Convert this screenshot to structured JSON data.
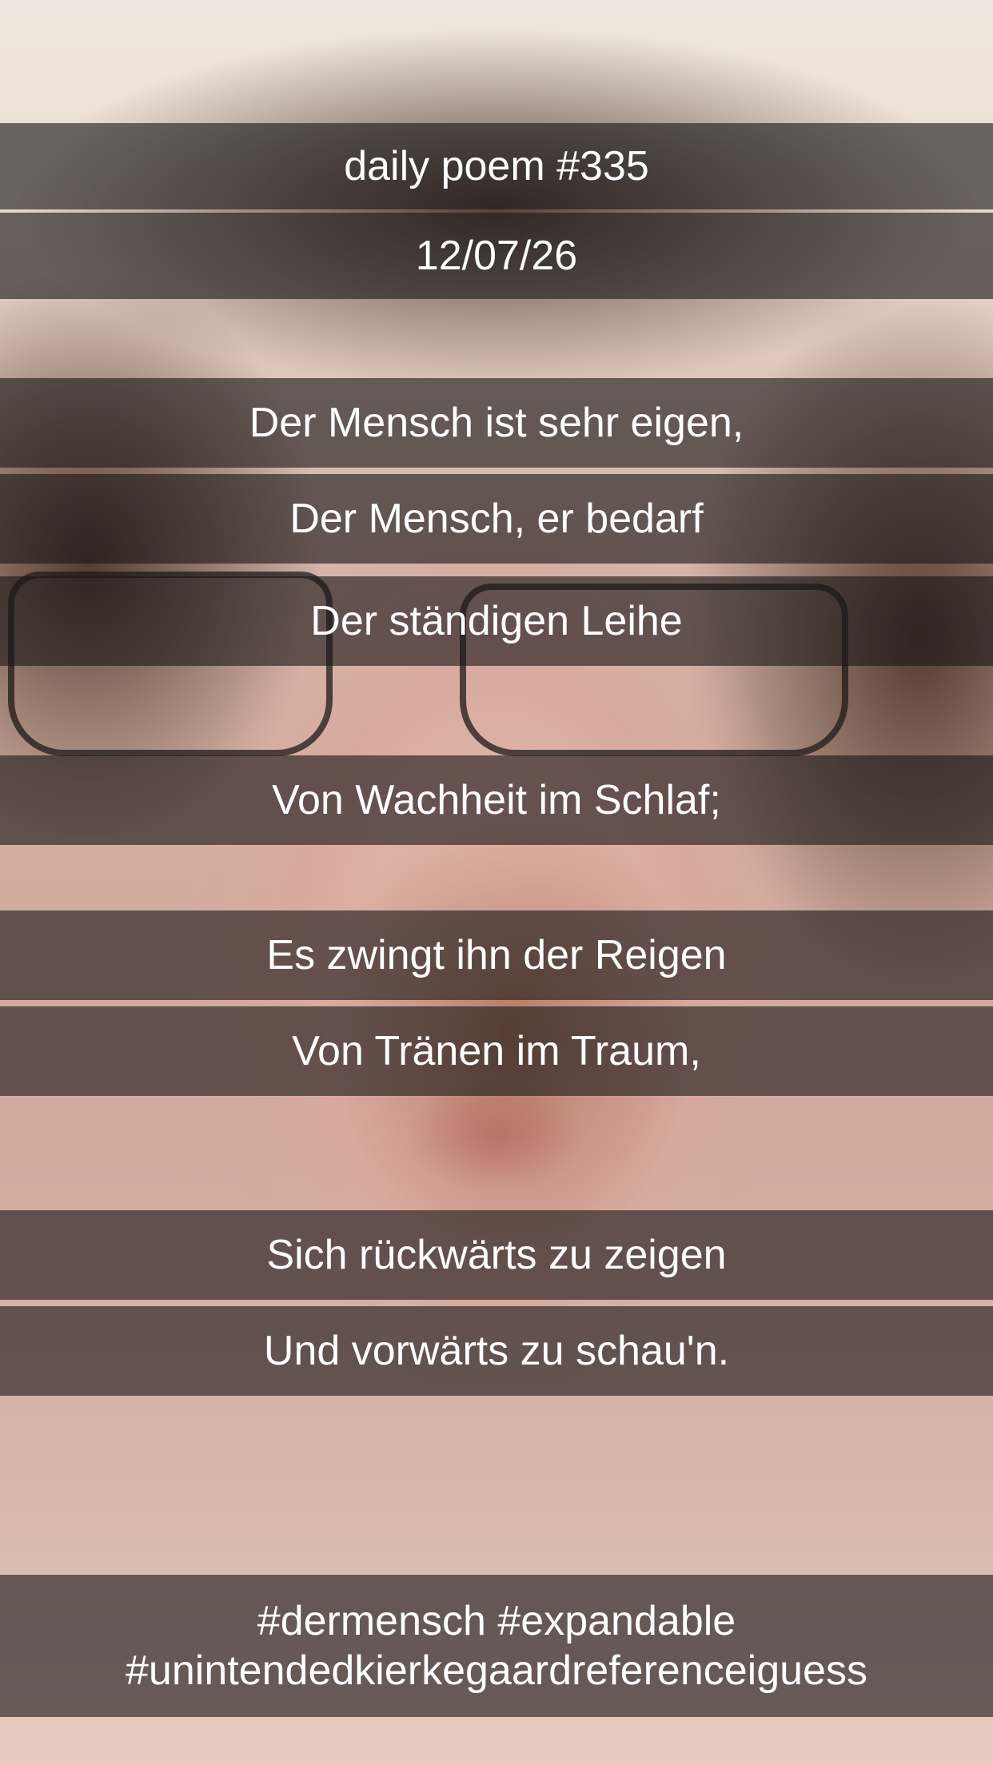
{
  "post": {
    "title": "daily poem #335",
    "date": "12/07/26",
    "lines": [
      "Der Mensch ist sehr eigen,",
      "Der Mensch, er bedarf",
      "Der ständigen Leihe",
      "Von Wachheit im Schlaf;",
      "Es zwingt ihn der Reigen",
      "Von Tränen im Traum,",
      "Sich rückwärts zu zeigen",
      "Und vorwärts zu schau'n."
    ],
    "hashtags": [
      "#dermensch #expandable",
      "#unintendedkierkegaardreferenceiguess"
    ]
  },
  "colors": {
    "band": "#1c1818",
    "text": "#ffffff"
  }
}
